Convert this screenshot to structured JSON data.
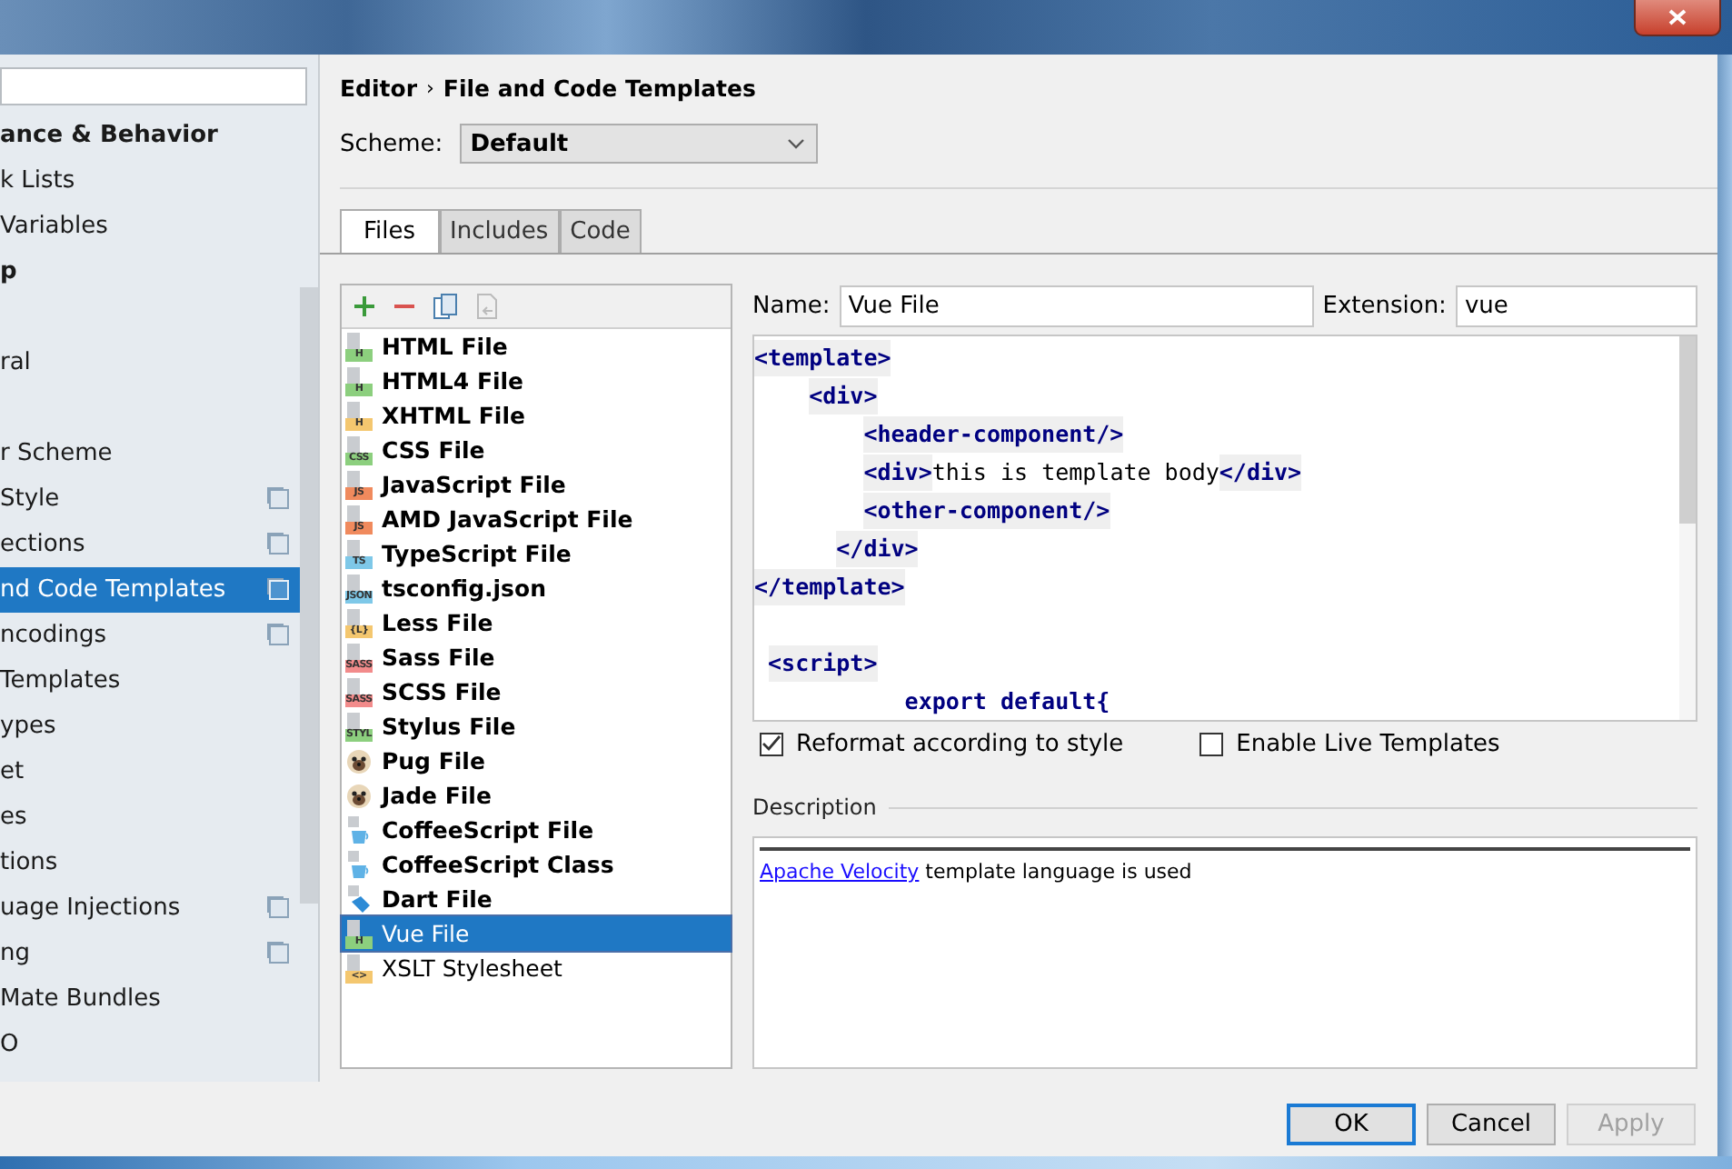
{
  "sidebar": {
    "items": [
      {
        "label": "ance & Behavior",
        "bold": true,
        "selected": false,
        "project_icon": false
      },
      {
        "label": "k Lists",
        "bold": false,
        "selected": false,
        "project_icon": false
      },
      {
        "label": "Variables",
        "bold": false,
        "selected": false,
        "project_icon": false
      },
      {
        "label": "p",
        "bold": true,
        "selected": false,
        "project_icon": false
      },
      {
        "label": "ral",
        "bold": false,
        "selected": false,
        "project_icon": false
      },
      {
        "label": "r Scheme",
        "bold": false,
        "selected": false,
        "project_icon": false
      },
      {
        "label": "Style",
        "bold": false,
        "selected": false,
        "project_icon": true
      },
      {
        "label": "ections",
        "bold": false,
        "selected": false,
        "project_icon": true
      },
      {
        "label": "nd Code Templates",
        "bold": false,
        "selected": true,
        "project_icon": true
      },
      {
        "label": "ncodings",
        "bold": false,
        "selected": false,
        "project_icon": true
      },
      {
        "label": "Templates",
        "bold": false,
        "selected": false,
        "project_icon": false
      },
      {
        "label": "ypes",
        "bold": false,
        "selected": false,
        "project_icon": false
      },
      {
        "label": "et",
        "bold": false,
        "selected": false,
        "project_icon": false
      },
      {
        "label": "es",
        "bold": false,
        "selected": false,
        "project_icon": false
      },
      {
        "label": "tions",
        "bold": false,
        "selected": false,
        "project_icon": false
      },
      {
        "label": "uage Injections",
        "bold": false,
        "selected": false,
        "project_icon": true
      },
      {
        "label": "ng",
        "bold": false,
        "selected": false,
        "project_icon": true
      },
      {
        "label": "Mate Bundles",
        "bold": false,
        "selected": false,
        "project_icon": false
      },
      {
        "label": "O",
        "bold": false,
        "selected": false,
        "project_icon": false
      }
    ]
  },
  "breadcrumb": {
    "parent": "Editor",
    "separator": "›",
    "current": "File and Code Templates"
  },
  "scheme": {
    "label": "Scheme:",
    "value": "Default"
  },
  "tabs": [
    {
      "label": "Files",
      "selected": true
    },
    {
      "label": "Includes",
      "selected": false
    },
    {
      "label": "Code",
      "selected": false
    }
  ],
  "templates": [
    {
      "label": "HTML File",
      "bold": true,
      "selected": false,
      "kind": "badge",
      "badge": "H",
      "color": "#8ccf7e"
    },
    {
      "label": "HTML4 File",
      "bold": true,
      "selected": false,
      "kind": "badge",
      "badge": "H",
      "color": "#8ccf7e"
    },
    {
      "label": "XHTML File",
      "bold": true,
      "selected": false,
      "kind": "badge",
      "badge": "H",
      "color": "#f4c76f"
    },
    {
      "label": "CSS File",
      "bold": true,
      "selected": false,
      "kind": "badge",
      "badge": "CSS",
      "color": "#8ccf7e"
    },
    {
      "label": "JavaScript File",
      "bold": true,
      "selected": false,
      "kind": "badge",
      "badge": "JS",
      "color": "#f08a5d"
    },
    {
      "label": "AMD JavaScript File",
      "bold": true,
      "selected": false,
      "kind": "badge",
      "badge": "JS",
      "color": "#f08a5d"
    },
    {
      "label": "TypeScript File",
      "bold": true,
      "selected": false,
      "kind": "badge",
      "badge": "TS",
      "color": "#7ec8e8"
    },
    {
      "label": "tsconfig.json",
      "bold": true,
      "selected": false,
      "kind": "badge",
      "badge": "JSON",
      "color": "#7ec8e8"
    },
    {
      "label": "Less File",
      "bold": true,
      "selected": false,
      "kind": "badge",
      "badge": "{L}",
      "color": "#f4c76f"
    },
    {
      "label": "Sass File",
      "bold": true,
      "selected": false,
      "kind": "badge",
      "badge": "SASS",
      "color": "#f28b8b"
    },
    {
      "label": "SCSS File",
      "bold": true,
      "selected": false,
      "kind": "badge",
      "badge": "SASS",
      "color": "#f28b8b"
    },
    {
      "label": "Stylus File",
      "bold": true,
      "selected": false,
      "kind": "badge",
      "badge": "STYL",
      "color": "#8ccf7e"
    },
    {
      "label": "Pug File",
      "bold": true,
      "selected": false,
      "kind": "pug"
    },
    {
      "label": "Jade File",
      "bold": true,
      "selected": false,
      "kind": "pug"
    },
    {
      "label": "CoffeeScript File",
      "bold": true,
      "selected": false,
      "kind": "cup"
    },
    {
      "label": "CoffeeScript Class",
      "bold": true,
      "selected": false,
      "kind": "cup"
    },
    {
      "label": "Dart File",
      "bold": true,
      "selected": false,
      "kind": "dart"
    },
    {
      "label": "Vue File",
      "bold": false,
      "selected": true,
      "kind": "badge",
      "badge": "H",
      "color": "#8ccf7e"
    },
    {
      "label": "XSLT Stylesheet",
      "bold": false,
      "selected": false,
      "kind": "badge",
      "badge": "<>",
      "color": "#f4c76f"
    }
  ],
  "name_field": {
    "label": "Name:",
    "value": "Vue File"
  },
  "extension_field": {
    "label": "Extension:",
    "value": "vue"
  },
  "code": [
    {
      "kind": "code",
      "segments": [
        {
          "kind": "tag",
          "text": "<template>"
        }
      ]
    },
    {
      "kind": "code",
      "segments": [
        {
          "kind": "tag",
          "text": "    <div>"
        }
      ]
    },
    {
      "kind": "code",
      "segments": [
        {
          "kind": "tag",
          "text": "        <header-component/>"
        }
      ]
    },
    {
      "kind": "code",
      "segments": [
        {
          "kind": "tag",
          "text": "        <div>"
        },
        {
          "kind": "text",
          "text": "this is template body"
        },
        {
          "kind": "tag",
          "text": "</div>"
        }
      ]
    },
    {
      "kind": "code",
      "segments": [
        {
          "kind": "tag",
          "text": "        <other-component/>"
        }
      ]
    },
    {
      "kind": "code",
      "segments": [
        {
          "kind": "tag",
          "text": "      </div>"
        }
      ]
    },
    {
      "kind": "code",
      "segments": [
        {
          "kind": "tag",
          "text": "</template>"
        }
      ]
    },
    {
      "kind": "blank"
    },
    {
      "kind": "code",
      "segments": [
        {
          "kind": "tag",
          "text": " <script>"
        }
      ]
    },
    {
      "kind": "code",
      "segments": [
        {
          "kind": "keyword",
          "text": "           export default{"
        }
      ]
    }
  ],
  "options": [
    {
      "label": "Reformat according to style",
      "checked": true
    },
    {
      "label": "Enable Live Templates",
      "checked": false
    }
  ],
  "description": {
    "title": "Description",
    "link": "Apache Velocity",
    "text": " template language is used"
  },
  "buttons": [
    {
      "label": "OK",
      "kind": "default"
    },
    {
      "label": "Cancel",
      "kind": "normal"
    },
    {
      "label": "Apply",
      "kind": "disabled"
    }
  ]
}
